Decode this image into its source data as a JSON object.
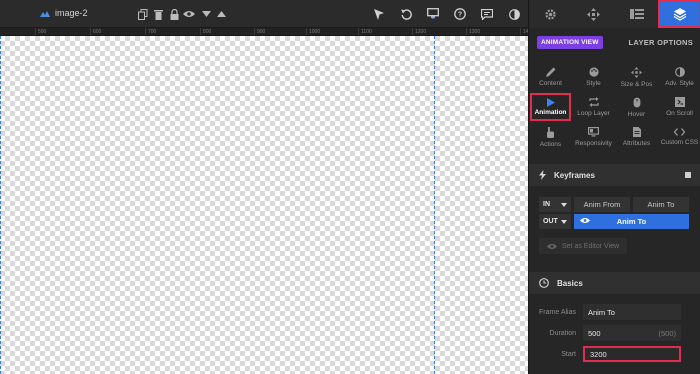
{
  "toolbar": {
    "layer_name": "image-2",
    "icons": [
      "cursor-icon",
      "undo-icon",
      "desktop-icon",
      "help-icon",
      "chat-icon",
      "contrast-icon"
    ]
  },
  "ruler": {
    "ticks": [
      "500",
      "600",
      "700",
      "800",
      "900",
      "1000",
      "1100",
      "1200",
      "1300",
      "14"
    ]
  },
  "panel": {
    "tabs": [
      "settings-tab",
      "navigation-tab",
      "layers-list-tab",
      "layer-stack-tab"
    ],
    "badge": "ANIMATION VIEW",
    "layer_options": "LAYER OPTIONS",
    "grid": [
      {
        "label": "Content",
        "icon": "pencil-icon"
      },
      {
        "label": "Style",
        "icon": "palette-icon"
      },
      {
        "label": "Size & Pos",
        "icon": "move-icon"
      },
      {
        "label": "Adv. Style",
        "icon": "contrast-icon"
      },
      {
        "label": "Animation",
        "icon": "play-icon"
      },
      {
        "label": "Loop Layer",
        "icon": "loop-icon"
      },
      {
        "label": "Hover",
        "icon": "mouse-icon"
      },
      {
        "label": "On Scroll",
        "icon": "scroll-icon"
      },
      {
        "label": "Actions",
        "icon": "hand-icon"
      },
      {
        "label": "Responsivity",
        "icon": "monitor-icon"
      },
      {
        "label": "Attributes",
        "icon": "document-icon"
      },
      {
        "label": "Custom CSS",
        "icon": "code-icon"
      }
    ],
    "keyframes": {
      "title": "Keyframes",
      "in_label": "IN",
      "out_label": "OUT",
      "anim_from": "Anim From",
      "anim_to": "Anim To",
      "anim_to_active": "Anim To",
      "set_editor_view": "Set as Editor View"
    },
    "basics": {
      "title": "Basics",
      "frame_alias_label": "Frame Alias",
      "frame_alias_value": "Anim To",
      "duration_label": "Duration",
      "duration_value": "500",
      "duration_hint": "(500)",
      "start_label": "Start",
      "start_value": "3200"
    }
  },
  "colors": {
    "accent_blue": "#2f6fde",
    "highlight_red": "#e32d4f",
    "badge_purple": "#7b3fe4"
  }
}
